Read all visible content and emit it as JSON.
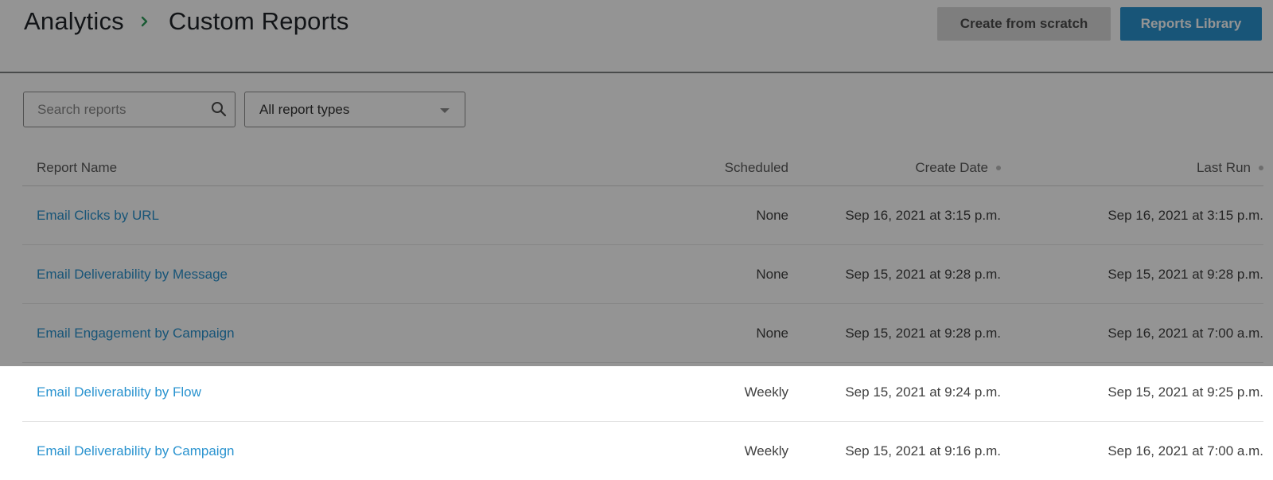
{
  "header": {
    "breadcrumb": {
      "root": "Analytics",
      "current": "Custom Reports"
    },
    "buttons": {
      "create_from_scratch": "Create from scratch",
      "reports_library": "Reports Library"
    }
  },
  "filters": {
    "search": {
      "placeholder": "Search reports",
      "value": ""
    },
    "report_type": {
      "selected": "All report types"
    }
  },
  "table": {
    "columns": {
      "name": "Report Name",
      "scheduled": "Scheduled",
      "create_date": "Create Date",
      "last_run": "Last Run"
    },
    "rows": [
      {
        "name": "Email Clicks by URL",
        "scheduled": "None",
        "create_date": "Sep 16, 2021 at 3:15 p.m.",
        "last_run": "Sep 16, 2021 at 3:15 p.m."
      },
      {
        "name": "Email Deliverability by Message",
        "scheduled": "None",
        "create_date": "Sep 15, 2021 at 9:28 p.m.",
        "last_run": "Sep 15, 2021 at 9:28 p.m."
      },
      {
        "name": "Email Engagement by Campaign",
        "scheduled": "None",
        "create_date": "Sep 15, 2021 at 9:28 p.m.",
        "last_run": "Sep 16, 2021 at 7:00 a.m."
      },
      {
        "name": "Email Deliverability by Flow",
        "scheduled": "Weekly",
        "create_date": "Sep 15, 2021 at 9:24 p.m.",
        "last_run": "Sep 15, 2021 at 9:25 p.m."
      },
      {
        "name": "Email Deliverability by Campaign",
        "scheduled": "Weekly",
        "create_date": "Sep 15, 2021 at 9:16 p.m.",
        "last_run": "Sep 16, 2021 at 7:00 a.m."
      }
    ]
  },
  "icons": {
    "breadcrumb_separator": "chevron-right-icon",
    "search": "search-icon",
    "select_caret": "caret-down-icon",
    "sort": "sort-dot-icon"
  },
  "colors": {
    "accent": "#2a93cf",
    "breadcrumb_separator": "#2e9c5a",
    "secondary_button": "#d9d9d9",
    "overlay": "rgba(0,0,0,0.42)"
  }
}
